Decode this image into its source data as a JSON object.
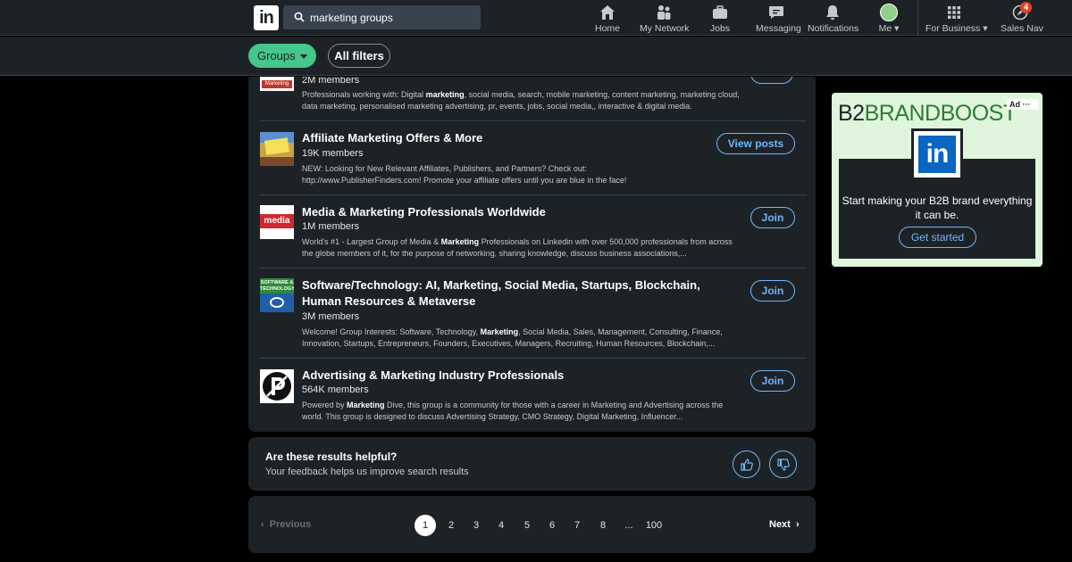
{
  "nav": {
    "logo": "in",
    "search_value": "marketing groups",
    "items": [
      {
        "label": "Home"
      },
      {
        "label": "My Network"
      },
      {
        "label": "Jobs"
      },
      {
        "label": "Messaging"
      },
      {
        "label": "Notifications"
      },
      {
        "label": "Me"
      },
      {
        "label": "For Business"
      },
      {
        "label": "Sales Nav",
        "badge": "4"
      }
    ]
  },
  "filters": {
    "groups_label": "Groups",
    "all_filters_label": "All filters"
  },
  "results": [
    {
      "members": "2M members",
      "description_parts": [
        "Professionals working with: Digital ",
        "marketing",
        ", social media, search, mobile marketing, content marketing, marketing cloud, data marketing, personalised marketing advertising, pr, events, jobs, social media,, interactive & digital media."
      ],
      "thumb_text": "Marketing"
    },
    {
      "title": "Affiliate Marketing Offers & More",
      "members": "19K members",
      "description_parts": [
        "NEW: Looking for New Relevant Affiliates, Publishers, and Partners? Check out: http://www.PublisherFinders.com! Promote your affiliate offers until you are blue in the face!"
      ],
      "button": "View posts"
    },
    {
      "title": "Media & Marketing Professionals Worldwide",
      "members": "1M members",
      "description_parts": [
        "World's #1 - Largest Group of Media & ",
        "Marketing",
        " Professionals on Linkedin with over 500,000 professionals from across the globe members of it, for the purpose of networking, sharing knowledge, discuss business associations,..."
      ],
      "button": "Join",
      "thumb_text": "media"
    },
    {
      "title": "Software/Technology: AI, Marketing, Social Media, Startups, Blockchain, Human Resources & Metaverse",
      "members": "3M members",
      "description_parts": [
        "Welcome! Group Interests: Software, Technology, ",
        "Marketing",
        ", Social Media, Sales, Management, Consulting, Finance, Innovation, Startups, Entrepreneurs, Founders, Executives, Managers, Recruiting, Human Resources, Blockchain,..."
      ],
      "button": "Join",
      "thumb_text": "SOFTWARE & TECHNOLOGY"
    },
    {
      "title": "Advertising & Marketing Industry Professionals",
      "members": "564K members",
      "description_parts": [
        "Powered by ",
        "Marketing",
        " Dive, this group is a community for those with a career in Marketing and Advertising across the world. This group is designed to discuss Advertising Strategy, CMO Strategy, Digital Marketing, Influencer..."
      ],
      "button": "Join"
    }
  ],
  "feedback": {
    "title": "Are these results helpful?",
    "subtitle": "Your feedback helps us improve search results"
  },
  "pagination": {
    "previous": "Previous",
    "next": "Next",
    "pages": [
      "1",
      "2",
      "3",
      "4",
      "5",
      "6",
      "7",
      "8",
      "...",
      "100"
    ],
    "current": "1"
  },
  "ad": {
    "brand_prefix": "B2",
    "brand_name": "BRANDBOOST",
    "tag": "Ad",
    "logo": "in",
    "text": "Start making your B2B brand everything it can be.",
    "cta": "Get started"
  },
  "colors": {
    "page_bg": "#000000",
    "card_bg": "#1d2226",
    "accent_blue": "#71b7fb",
    "groups_green": "#44c68c",
    "ad_bg": "#dff5dc"
  }
}
